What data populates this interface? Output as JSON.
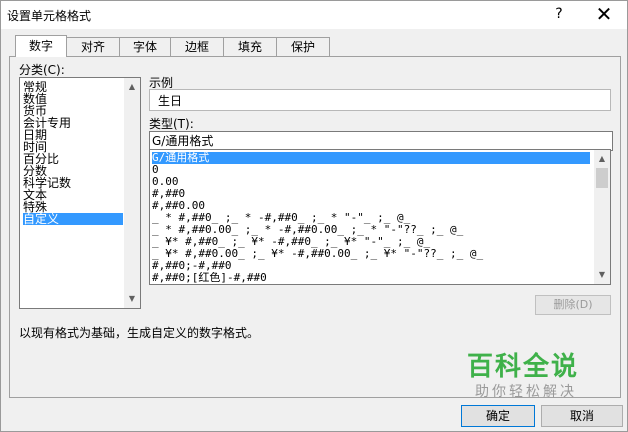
{
  "window": {
    "title": "设置单元格格式",
    "help_glyph": "?",
    "close_glyph": "✕"
  },
  "tabs": [
    {
      "label": "数字",
      "active": true
    },
    {
      "label": "对齐"
    },
    {
      "label": "字体"
    },
    {
      "label": "边框"
    },
    {
      "label": "填充"
    },
    {
      "label": "保护"
    }
  ],
  "category": {
    "label": "分类(C):",
    "items": [
      "常规",
      "数值",
      "货币",
      "会计专用",
      "日期",
      "时间",
      "百分比",
      "分数",
      "科学记数",
      "文本",
      "特殊",
      "自定义"
    ],
    "selected_index": 11
  },
  "sample": {
    "label": "示例",
    "value": "生日"
  },
  "type": {
    "label": "类型(T):",
    "input_value": "G/通用格式",
    "formats": [
      "G/通用格式",
      "0",
      "0.00",
      "#,##0",
      "#,##0.00",
      "_ * #,##0_ ;_ * -#,##0_ ;_ * \"-\"_ ;_ @_",
      "_ * #,##0.00_ ;_ * -#,##0.00_ ;_ * \"-\"??_ ;_ @_",
      "_ ¥* #,##0_ ;_ ¥* -#,##0_ ;_ ¥* \"-\"_ ;_ @_",
      "_ ¥* #,##0.00_ ;_ ¥* -#,##0.00_ ;_ ¥* \"-\"??_ ;_ @_",
      "#,##0;-#,##0",
      "#,##0;[红色]-#,##0"
    ],
    "selected_index": 0
  },
  "delete_label": "删除(D)",
  "description": "以现有格式为基础，生成自定义的数字格式。",
  "watermark": {
    "line1": "百科全说",
    "line2": "助你轻松解决"
  },
  "buttons": {
    "ok": "确定",
    "cancel": "取消"
  },
  "icons": {
    "scroll_up": "▲",
    "scroll_down": "▼"
  }
}
